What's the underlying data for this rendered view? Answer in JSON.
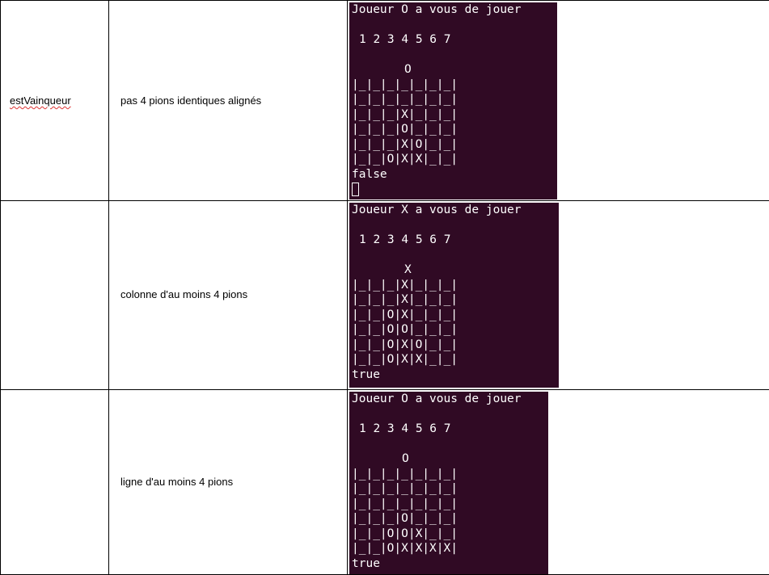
{
  "table": {
    "function_name": "estVainqueur",
    "rows": [
      {
        "description": "pas 4 pions identiques alignés",
        "terminal": {
          "header": "Joueur O a vous de jouer",
          "numbers": "1 2 3 4 5 6 7",
          "token": "O",
          "board": [
            "|_|_|_|_|_|_|_|",
            "|_|_|_|_|_|_|_|",
            "|_|_|_|X|_|_|_|",
            "|_|_|_|O|_|_|_|",
            "|_|_|_|X|O|_|_|",
            "|_|_|O|X|X|_|_|"
          ],
          "result": "false"
        }
      },
      {
        "description": "colonne d'au moins 4 pions",
        "terminal": {
          "header": "Joueur X a vous de jouer",
          "numbers": "1 2 3 4 5 6 7",
          "token": "X",
          "board": [
            "|_|_|_|X|_|_|_|",
            "|_|_|_|X|_|_|_|",
            "|_|_|O|X|_|_|_|",
            "|_|_|O|O|_|_|_|",
            "|_|_|O|X|O|_|_|",
            "|_|_|O|X|X|_|_|"
          ],
          "result": "true"
        }
      },
      {
        "description": "ligne d'au moins 4 pions",
        "terminal": {
          "header": "Joueur O a vous de jouer",
          "numbers": "1 2 3 4 5 6 7",
          "token": "O",
          "board": [
            "|_|_|_|_|_|_|_|",
            "|_|_|_|_|_|_|_|",
            "|_|_|_|_|_|_|_|",
            "|_|_|_|O|_|_|_|",
            "|_|_|O|O|X|_|_|",
            "|_|_|O|X|X|X|X|"
          ],
          "result": "true"
        }
      }
    ]
  },
  "colors": {
    "terminal_bg": "#300a24",
    "terminal_fg": "#ffffff",
    "border": "#000000"
  }
}
